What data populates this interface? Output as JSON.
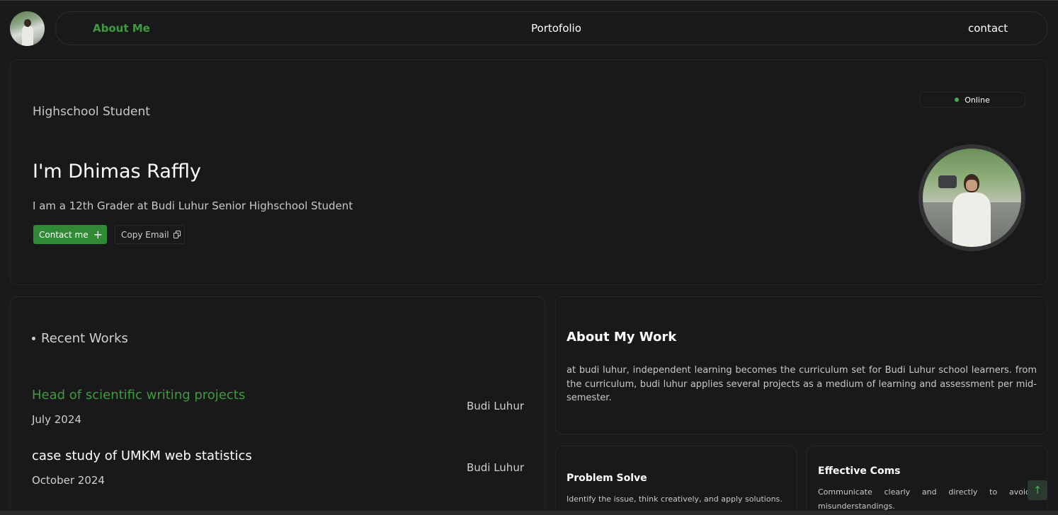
{
  "nav": {
    "about": "About Me",
    "portfolio": "Portofolio",
    "contact": "contact"
  },
  "hero": {
    "role": "Highschool Student",
    "name": "I'm Dhimas Raffly",
    "description": "I am a 12th Grader at Budi Luhur Senior Highschool Student",
    "contact_button": "Contact me",
    "copy_button": "Copy Email",
    "status": "Online"
  },
  "works": {
    "title": "Recent Works",
    "items": [
      {
        "title": "Head of scientific writing projects",
        "date": "July 2024",
        "place": "Budi Luhur"
      },
      {
        "title": "case study of UMKM web statistics",
        "date": "October 2024",
        "place": "Budi Luhur"
      }
    ]
  },
  "about": {
    "title": "About My Work",
    "text": "at budi luhur, independent learning becomes the curriculum set for Budi Luhur school learners. from the curriculum, budi luhur applies several projects as a medium of learning and assessment per mid-semester."
  },
  "skills": [
    {
      "title": "Problem Solve",
      "text": "Identify the issue, think creatively, and apply solutions."
    },
    {
      "title": "Effective Coms",
      "text": "Communicate clearly and directly to avoid misunderstandings."
    }
  ],
  "colors": {
    "accent_green": "#3d9b3d",
    "button_green": "#2f8a34",
    "status_dot": "#3fb14a",
    "background": "#1a1a1c"
  }
}
